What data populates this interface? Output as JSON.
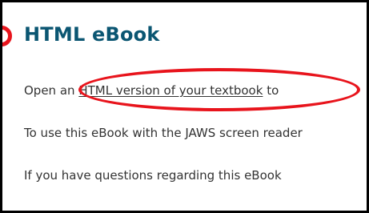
{
  "panel": {
    "heading": "HTML eBook",
    "line1_prefix": "Open an ",
    "link_text": "HTML version of your textbook",
    "line1_suffix": " to",
    "line2": "To use this eBook with the JAWS screen reader",
    "line3": "If you have questions regarding this eBook"
  },
  "colors": {
    "heading": "#0b5672",
    "body_text": "#333333",
    "annotation": "#e8141c",
    "frame": "#000000"
  }
}
